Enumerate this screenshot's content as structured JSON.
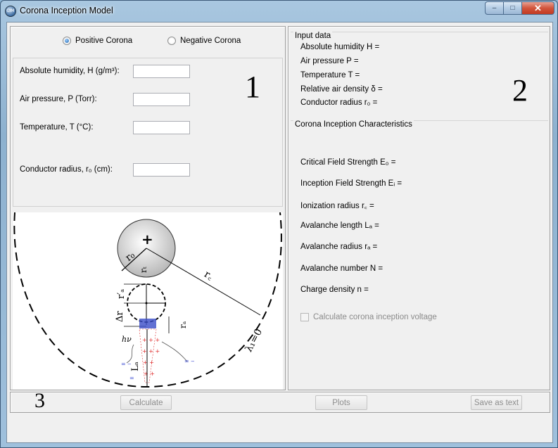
{
  "window": {
    "title": "Corona Inception Model",
    "icon_text": "CIM",
    "minimize": "–",
    "maximize": "□",
    "close": "✕"
  },
  "polarity": {
    "positive_label": "Positive Corona",
    "negative_label": "Negative Corona",
    "selected": "positive"
  },
  "inputs": {
    "humidity_label": "Absolute humidity, H (g/m³):",
    "pressure_label": "Air pressure, P (Torr):",
    "temperature_label": "Temperature, T (°C):",
    "radius_label": "Conductor radius, r₀ (cm):",
    "humidity_value": "",
    "pressure_value": "",
    "temperature_value": "",
    "radius_value": ""
  },
  "region_numbers": {
    "one": "1",
    "two": "2",
    "three": "3"
  },
  "input_data": {
    "title": "Input data",
    "humidity": "Absolute humidity H =",
    "pressure": "Air pressure P =",
    "temperature": "Temperature T =",
    "density": "Relative air density δ =",
    "radius": "Conductor radius r₀ ="
  },
  "characteristics": {
    "title": "Corona Inception Characteristics",
    "critical_field": "Critical Field Strength E₀ =",
    "inception_field": "Inception Field Strength Eᵢ =",
    "ionization_radius": "Ionization radius r꜀ =",
    "avalanche_length": "Avalanche length Lₐ =",
    "avalanche_radius": "Avalanche radius rₐ =",
    "avalanche_number": "Avalanche number N =",
    "charge_density": "Charge density n =",
    "checkbox_label": "Calculate corona inception voltage"
  },
  "buttons": {
    "calculate": "Calculate",
    "plots": "Plots",
    "save": "Save as text"
  },
  "diagram": {
    "plus": "+",
    "r0": "r₀",
    "rt": "rₜ",
    "rc": "r꜀",
    "r_alpha_prime": "r′ₐ",
    "delta_r": "Δr",
    "r_alpha": "rₐ",
    "hv": "hν",
    "la": "Lₐ",
    "lambda": "λ₁=0"
  }
}
